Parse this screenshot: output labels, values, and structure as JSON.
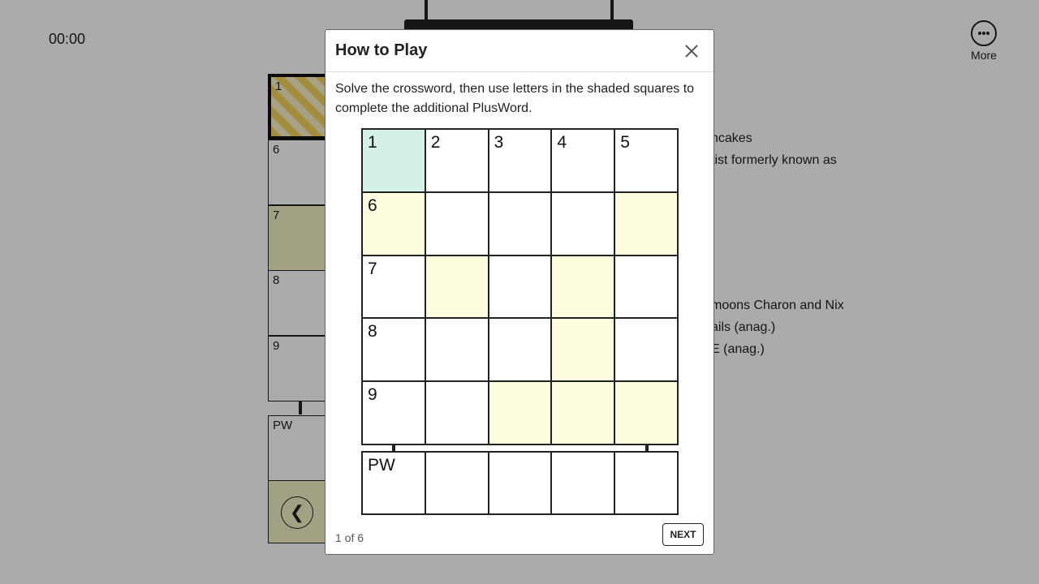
{
  "game": {
    "timer": "00:00",
    "more_label": "More",
    "board_numbers": [
      "1",
      "6",
      "7",
      "8",
      "9"
    ],
    "plusword_label": "PW",
    "back_arrow": "❮",
    "clue_fragments": [
      "ncakes",
      "tist formerly known as",
      "moons Charon and Nix",
      "ails (anag.)",
      "E (anag.)"
    ]
  },
  "modal": {
    "title": "How to Play",
    "body": "Solve the crossword, then use letters in the shaded squares to complete the additional PlusWord.",
    "grid_numbers": {
      "c0": "1",
      "c1": "2",
      "c2": "3",
      "c3": "4",
      "c4": "5",
      "c5": "6",
      "c10": "7",
      "c15": "8",
      "c20": "9"
    },
    "highlighted_cell": 0,
    "shaded_cells": [
      5,
      9,
      11,
      13,
      18,
      22,
      23,
      24
    ],
    "plusword_label": "PW",
    "page_indicator": "1 of 6",
    "next_label": "NEXT"
  },
  "colors": {
    "highlight": "#d5f0e5",
    "shaded": "#fefde0",
    "active_cell_stripe": "#f2d15d",
    "overlay": "rgba(0,0,0,0.33)"
  },
  "icons": [
    "more-icon",
    "close-icon",
    "back-arrow-icon"
  ]
}
